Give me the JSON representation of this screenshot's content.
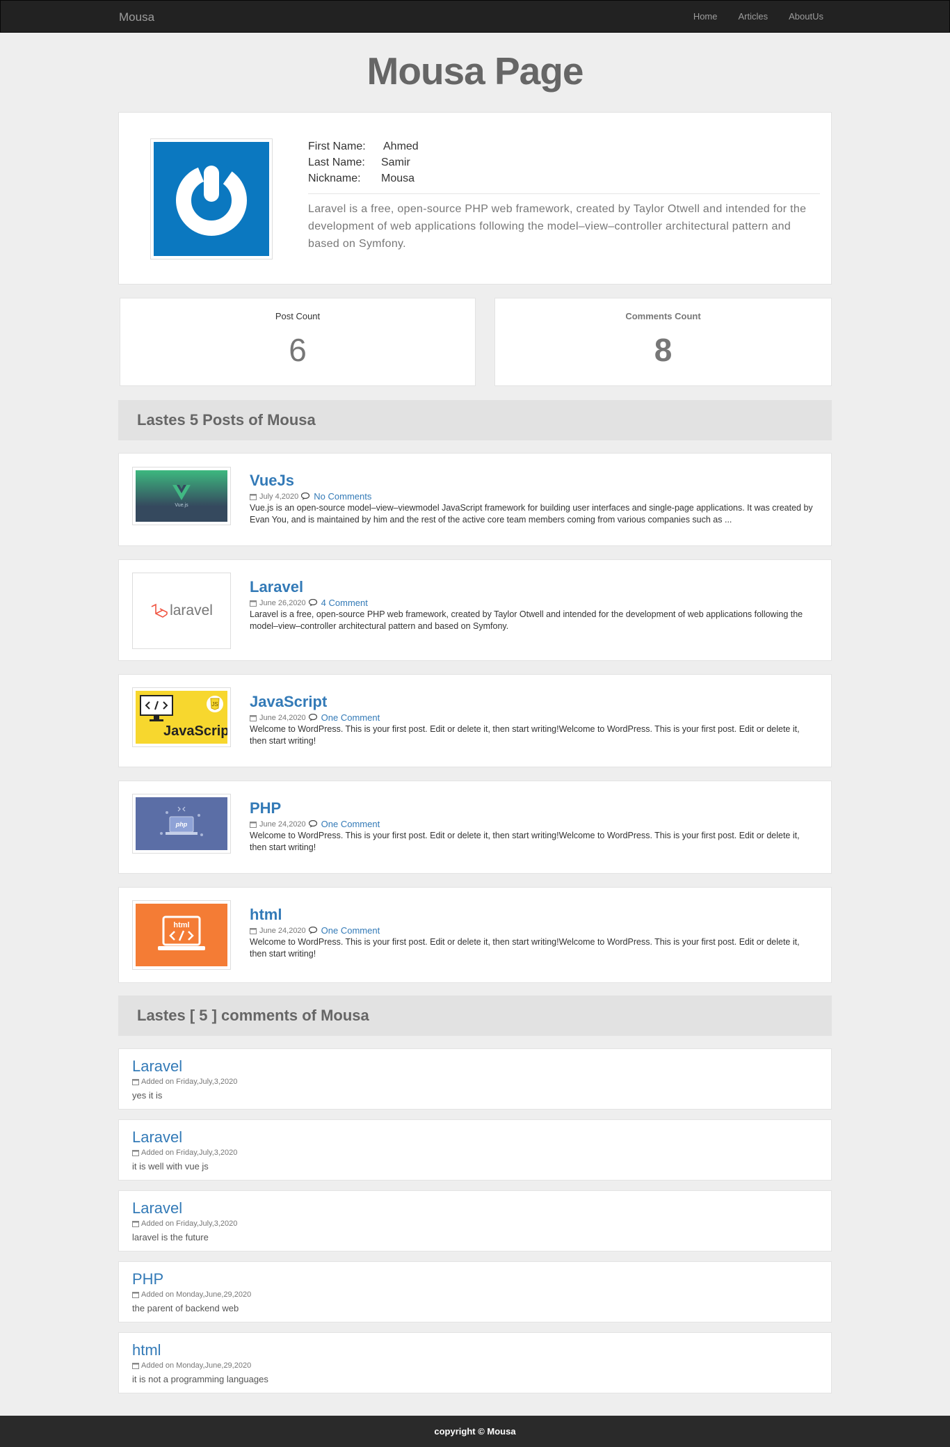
{
  "navbar": {
    "brand": "Mousa",
    "links": [
      "Home",
      "Articles",
      "AboutUs"
    ]
  },
  "page_title": "Mousa Page",
  "profile": {
    "first_name_label": "First Name:",
    "first_name": "Ahmed",
    "last_name_label": "Last Name:",
    "last_name": "Samir",
    "nickname_label": "Nickname:",
    "nickname": "Mousa",
    "bio": "Laravel is a free, open-source PHP web framework, created by Taylor Otwell and intended for the development of web applications following the model–view–controller architectural pattern and based on Symfony.",
    "avatar_icon": "power-button-logo-icon",
    "avatar_color": "#0b78c0"
  },
  "stats": {
    "post_count_label": "Post Count",
    "post_count": "6",
    "comments_count_label": "Comments Count",
    "comments_count": "8"
  },
  "posts_header": "Lastes 5 Posts of Mousa",
  "posts": [
    {
      "title": "VueJs",
      "date": "July 4,2020",
      "comments": "No Comments",
      "excerpt": "Vue.js is an open-source model–view–viewmodel JavaScript framework for building user interfaces and single-page applications. It was created by Evan You, and is maintained by him and the rest of the active core team members coming from various companies such as ...",
      "thumb_text": "Vue.js"
    },
    {
      "title": "Laravel",
      "date": "June 26,2020",
      "comments": "4 Comment",
      "excerpt": "Laravel is a free, open-source PHP web framework, created by Taylor Otwell and intended for the development of web applications following the model–view–controller architectural pattern and based on Symfony.",
      "thumb_text": "laravel"
    },
    {
      "title": "JavaScript",
      "date": "June 24,2020",
      "comments": "One Comment",
      "excerpt": "Welcome to WordPress. This is your first post. Edit or delete it, then start writing!Welcome to WordPress. This is your first post. Edit or delete it, then start writing!",
      "thumb_text": "JavaScript"
    },
    {
      "title": "PHP",
      "date": "June 24,2020",
      "comments": "One Comment",
      "excerpt": "Welcome to WordPress. This is your first post. Edit or delete it, then start writing!Welcome to WordPress. This is your first post. Edit or delete it, then start writing!",
      "thumb_text": "php"
    },
    {
      "title": "html",
      "date": "June 24,2020",
      "comments": "One Comment",
      "excerpt": "Welcome to WordPress. This is your first post. Edit or delete it, then start writing!Welcome to WordPress. This is your first post. Edit or delete it, then start writing!",
      "thumb_text": "html"
    }
  ],
  "comments_header": "Lastes [ 5 ] comments of Mousa",
  "comments": [
    {
      "title": "Laravel",
      "date": "Added on Friday,July,3,2020",
      "text": "yes it is"
    },
    {
      "title": "Laravel",
      "date": "Added on Friday,July,3,2020",
      "text": "it is well with vue js"
    },
    {
      "title": "Laravel",
      "date": "Added on Friday,July,3,2020",
      "text": "laravel is the future"
    },
    {
      "title": "PHP",
      "date": "Added on Monday,June,29,2020",
      "text": "the parent of backend web"
    },
    {
      "title": "html",
      "date": "Added on Monday,June,29,2020",
      "text": "it is not a programming languages"
    }
  ],
  "footer": "copyright © Mousa",
  "colors": {
    "navbar": "#222222",
    "link": "#337ab7",
    "page_bg": "#eeeeee",
    "section_header_bg": "#e2e2e2"
  }
}
